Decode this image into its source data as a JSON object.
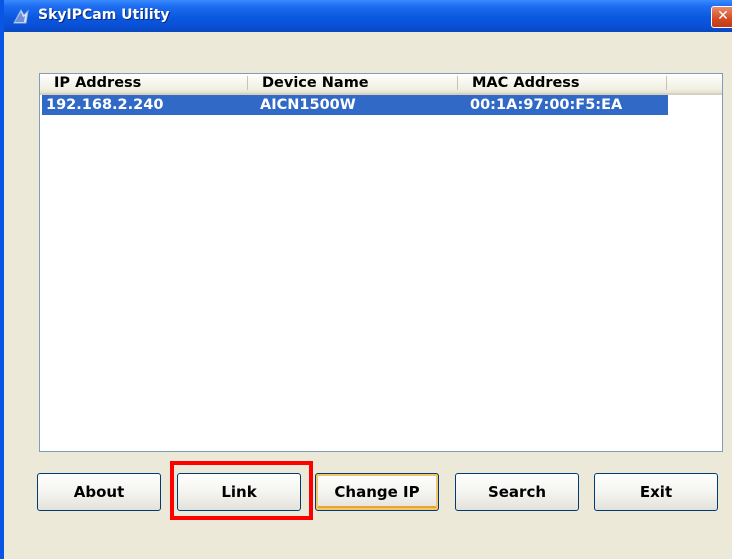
{
  "window": {
    "title": "SkyIPCam Utility",
    "close_glyph": "✕"
  },
  "device_list": {
    "columns": [
      "IP Address",
      "Device Name",
      "MAC Address"
    ],
    "rows": [
      {
        "ip": "192.168.2.240",
        "name": "AICN1500W",
        "mac": "00:1A:97:00:F5:EA"
      }
    ],
    "selected_row": 0
  },
  "buttons": {
    "about": "About",
    "link": "Link",
    "change_ip": "Change IP",
    "search": "Search",
    "exit": "Exit"
  },
  "annotation": {
    "highlighted_button": "link",
    "color": "#ff0000"
  },
  "colors": {
    "titlebar": "#0a58e0",
    "selection": "#3169c6",
    "dialog_bg": "#ece9d8"
  }
}
